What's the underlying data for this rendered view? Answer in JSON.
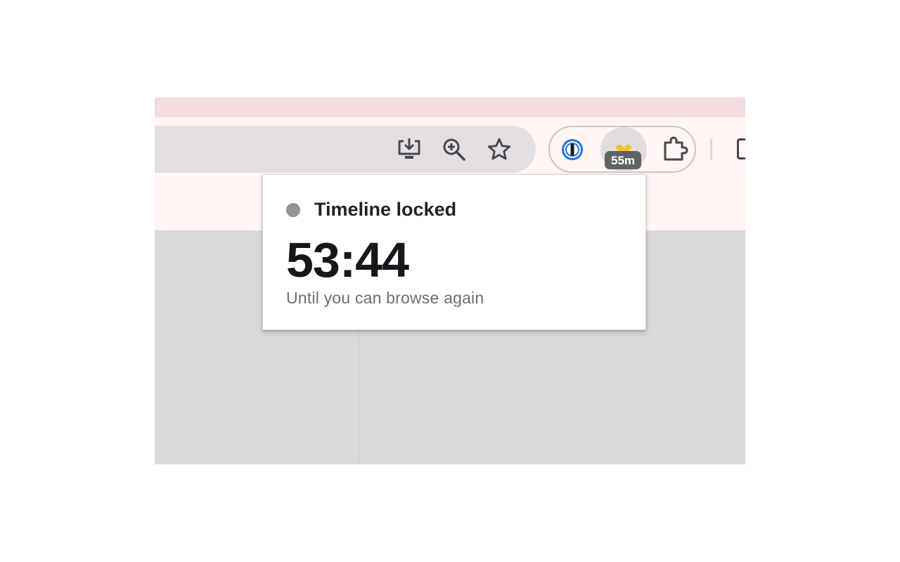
{
  "toolbar": {
    "omnibox_icons": [
      "install-app-icon",
      "zoom-in-icon",
      "bookmark-star-icon"
    ],
    "extensions": [
      {
        "name": "1Password",
        "icon": "onepassword-icon"
      },
      {
        "name": "Timeline",
        "icon": "timeline-extension-icon",
        "badge": "55m"
      },
      {
        "name": "Extensions",
        "icon": "puzzle-piece-icon"
      }
    ]
  },
  "popup": {
    "title": "Timeline locked",
    "timer": "53:44",
    "subtitle": "Until you can browse again"
  },
  "colors": {
    "tabstrip": "#f3dde0",
    "toolbar": "#fff6f5",
    "omnibox": "#e4dfe2",
    "badge": "#5f6367",
    "onepassword_blue": "#1a73e8",
    "timeline_yellow": "#f2c12e",
    "status_dot": "#919396",
    "content": "#dadada"
  }
}
